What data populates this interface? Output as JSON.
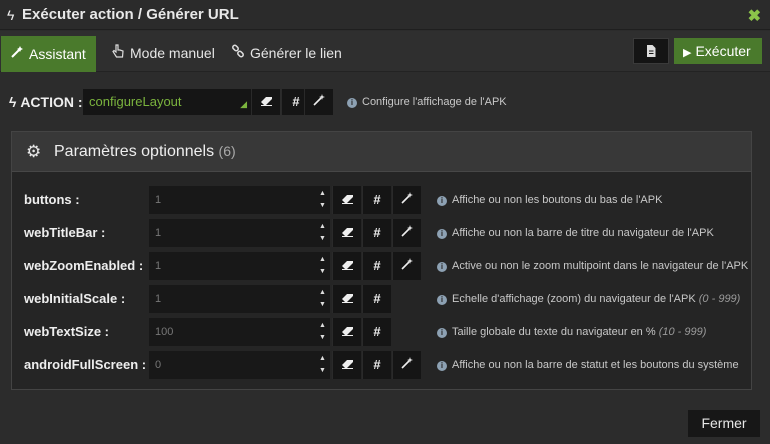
{
  "window": {
    "title": "Exécuter action / Générer URL",
    "close_icon": "✖"
  },
  "tabs": [
    {
      "label": "Assistant",
      "icon": "magic-wand-icon",
      "active": true
    },
    {
      "label": "Mode manuel",
      "icon": "hand-pointer-icon",
      "active": false
    },
    {
      "label": "Générer le lien",
      "icon": "link-icon",
      "active": false
    }
  ],
  "toolbar": {
    "execute_label": "Exécuter",
    "doc_icon": "file-icon"
  },
  "action": {
    "label": "ACTION :",
    "selected": "configureLayout",
    "hint": "Configure l'affichage de l'APK"
  },
  "params_panel": {
    "title": "Paramètres optionnels",
    "count": "(6)",
    "rows": [
      {
        "name": "buttons :",
        "value": "1",
        "hint": "Affiche ou non les boutons du bas de l'APK",
        "range": ""
      },
      {
        "name": "webTitleBar :",
        "value": "1",
        "hint": "Affiche ou non la barre de titre du navigateur de l'APK",
        "range": ""
      },
      {
        "name": "webZoomEnabled :",
        "value": "1",
        "hint": "Active ou non le zoom multipoint dans le navigateur de l'APK",
        "range": ""
      },
      {
        "name": "webInitialScale :",
        "value": "1",
        "hint": "Echelle d'affichage (zoom) du navigateur de l'APK",
        "range": "(0 - 999)"
      },
      {
        "name": "webTextSize :",
        "value": "100",
        "hint": "Taille globale du texte du navigateur en %",
        "range": "(10 - 999)"
      },
      {
        "name": "androidFullScreen :",
        "value": "0",
        "hint": "Affiche ou non la barre de statut et les boutons du système",
        "range": ""
      }
    ]
  },
  "footer": {
    "close_label": "Fermer"
  },
  "colors": {
    "accent_green": "#4a7a2c",
    "select_text": "#7bb43e",
    "close_x": "#8bc34a"
  }
}
